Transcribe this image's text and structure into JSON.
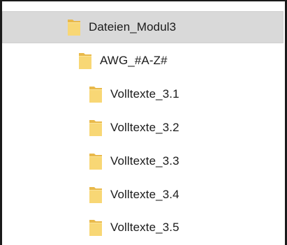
{
  "tree": {
    "items": [
      {
        "label": "Dateien_Modul3",
        "level": 0,
        "selected": true,
        "icon": "folder-icon"
      },
      {
        "label": "AWG_#A-Z#",
        "level": 1,
        "selected": false,
        "icon": "folder-icon"
      },
      {
        "label": "Volltexte_3.1",
        "level": 2,
        "selected": false,
        "icon": "folder-icon"
      },
      {
        "label": "Volltexte_3.2",
        "level": 2,
        "selected": false,
        "icon": "folder-icon"
      },
      {
        "label": "Volltexte_3.3",
        "level": 2,
        "selected": false,
        "icon": "folder-icon"
      },
      {
        "label": "Volltexte_3.4",
        "level": 2,
        "selected": false,
        "icon": "folder-icon"
      },
      {
        "label": "Volltexte_3.5",
        "level": 2,
        "selected": false,
        "icon": "folder-icon"
      }
    ]
  },
  "colors": {
    "folder_body": "#f8d775",
    "folder_tab": "#e9b94a",
    "selection_bg": "#d9d9d9",
    "text": "#1b1b1b"
  }
}
